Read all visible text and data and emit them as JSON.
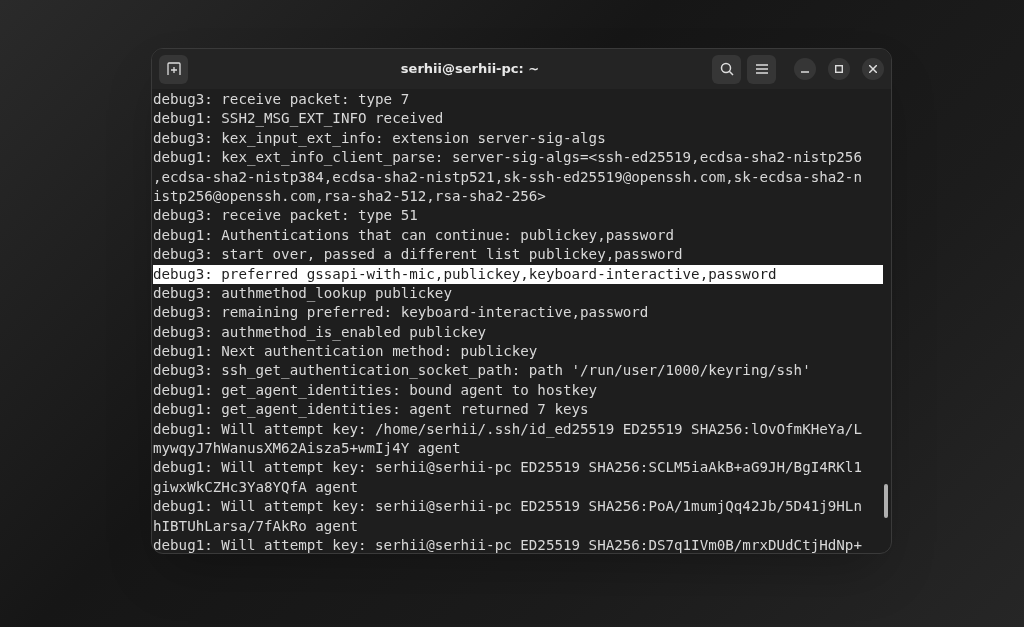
{
  "window": {
    "title": "serhii@serhii-pc: ~"
  },
  "terminal": {
    "lines": [
      {
        "text": "debug3: receive packet: type 7",
        "selected": false
      },
      {
        "text": "debug1: SSH2_MSG_EXT_INFO received",
        "selected": false
      },
      {
        "text": "debug3: kex_input_ext_info: extension server-sig-algs",
        "selected": false
      },
      {
        "text": "debug1: kex_ext_info_client_parse: server-sig-algs=<ssh-ed25519,ecdsa-sha2-nistp256",
        "selected": false
      },
      {
        "text": ",ecdsa-sha2-nistp384,ecdsa-sha2-nistp521,sk-ssh-ed25519@openssh.com,sk-ecdsa-sha2-n",
        "selected": false
      },
      {
        "text": "istp256@openssh.com,rsa-sha2-512,rsa-sha2-256>",
        "selected": false
      },
      {
        "text": "debug3: receive packet: type 51",
        "selected": false
      },
      {
        "text": "debug1: Authentications that can continue: publickey,password",
        "selected": false
      },
      {
        "text": "debug3: start over, passed a different list publickey,password",
        "selected": false
      },
      {
        "text": "debug3: preferred gssapi-with-mic,publickey,keyboard-interactive,password",
        "selected": true
      },
      {
        "text": "debug3: authmethod_lookup publickey",
        "selected": false
      },
      {
        "text": "debug3: remaining preferred: keyboard-interactive,password",
        "selected": false
      },
      {
        "text": "debug3: authmethod_is_enabled publickey",
        "selected": false
      },
      {
        "text": "debug1: Next authentication method: publickey",
        "selected": false
      },
      {
        "text": "debug3: ssh_get_authentication_socket_path: path '/run/user/1000/keyring/ssh'",
        "selected": false
      },
      {
        "text": "debug1: get_agent_identities: bound agent to hostkey",
        "selected": false
      },
      {
        "text": "debug1: get_agent_identities: agent returned 7 keys",
        "selected": false
      },
      {
        "text": "debug1: Will attempt key: /home/serhii/.ssh/id_ed25519 ED25519 SHA256:lOvOfmKHeYa/L",
        "selected": false
      },
      {
        "text": "mywqyJ7hWanusXM62Aisza5+wmIj4Y agent",
        "selected": false
      },
      {
        "text": "debug1: Will attempt key: serhii@serhii-pc ED25519 SHA256:SCLM5iaAkB+aG9JH/BgI4RKl1",
        "selected": false
      },
      {
        "text": "giwxWkCZHc3Ya8YQfA agent",
        "selected": false
      },
      {
        "text": "debug1: Will attempt key: serhii@serhii-pc ED25519 SHA256:PoA/1mumjQq42Jb/5D41j9HLn",
        "selected": false
      },
      {
        "text": "hIBTUhLarsa/7fAkRo agent",
        "selected": false
      },
      {
        "text": "debug1: Will attempt key: serhii@serhii-pc ED25519 SHA256:DS7q1IVm0B/mrxDUdCtjHdNp+",
        "selected": false
      }
    ]
  }
}
